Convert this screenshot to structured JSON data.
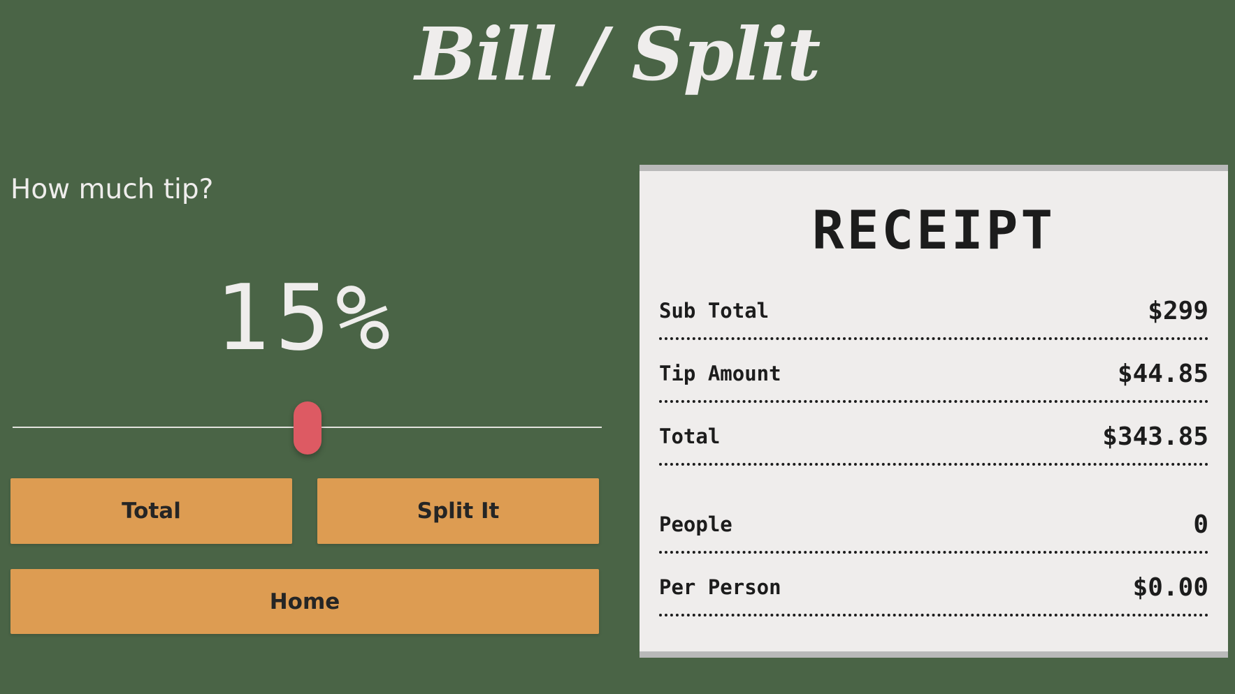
{
  "app": {
    "title": "Bill / Split"
  },
  "tip": {
    "question": "How much tip?",
    "percent_display": "15%",
    "slider_fraction": 0.5
  },
  "buttons": {
    "total_label": "Total",
    "split_label": "Split It",
    "home_label": "Home"
  },
  "receipt": {
    "title": "RECEIPT",
    "rows": [
      {
        "label": "Sub Total",
        "value": "$299"
      },
      {
        "label": "Tip Amount",
        "value": "$44.85"
      },
      {
        "label": "Total",
        "value": "$343.85"
      },
      {
        "label": "People",
        "value": "0"
      },
      {
        "label": "Per Person",
        "value": "$0.00"
      }
    ]
  },
  "colors": {
    "background": "#4a6446",
    "text_light": "#efedec",
    "button": "#dd9c52",
    "slider_thumb": "#dd5a63",
    "receipt_paper": "#efedec",
    "receipt_edge": "#b9b9b9"
  }
}
